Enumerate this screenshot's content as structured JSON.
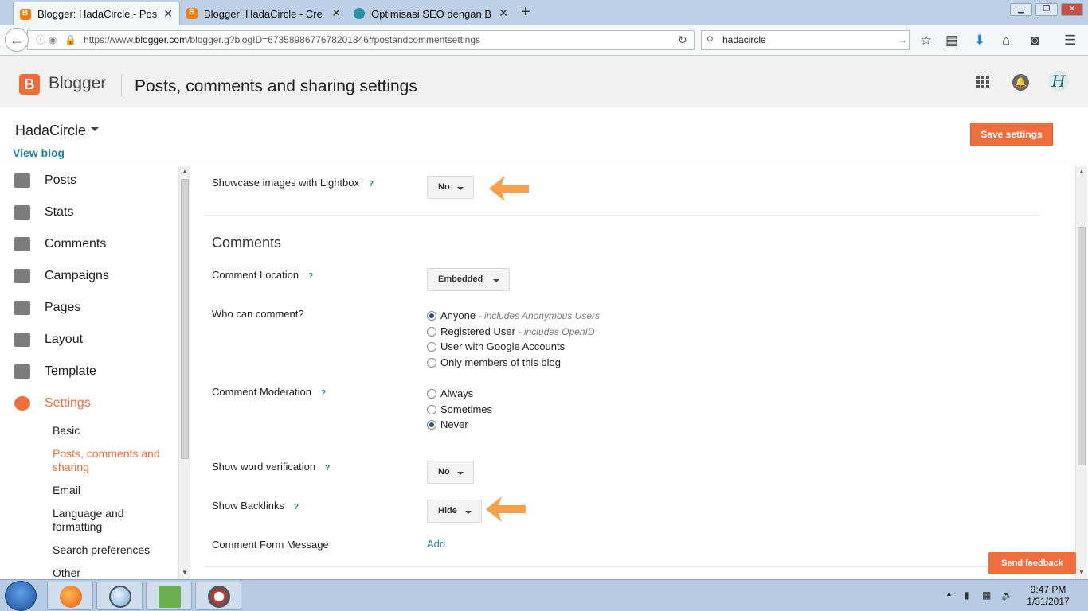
{
  "browser": {
    "tabs": [
      {
        "title": "Blogger: HadaCircle - Post...",
        "active": true
      },
      {
        "title": "Blogger: HadaCircle - Crea...",
        "active": false
      },
      {
        "title": "Optimisasi SEO dengan Blo...",
        "active": false
      }
    ],
    "url_prefix": "https://www.",
    "url_domain": "blogger.com",
    "url_rest": "/blogger.g?blogID=6735898677678201846#postandcommentsettings",
    "search_value": "hadacircle"
  },
  "header": {
    "brand": "Blogger",
    "page_title": "Posts, comments and sharing settings"
  },
  "blog": {
    "title": "HadaCircle",
    "view_blog": "View blog",
    "save_label": "Save settings"
  },
  "sidebar": {
    "items": [
      {
        "label": "Posts",
        "icon": "posts-icon"
      },
      {
        "label": "Stats",
        "icon": "stats-icon"
      },
      {
        "label": "Comments",
        "icon": "comments-icon"
      },
      {
        "label": "Campaigns",
        "icon": "campaigns-icon"
      },
      {
        "label": "Pages",
        "icon": "pages-icon"
      },
      {
        "label": "Layout",
        "icon": "layout-icon"
      },
      {
        "label": "Template",
        "icon": "template-icon"
      },
      {
        "label": "Settings",
        "icon": "gear-icon",
        "selected": true
      }
    ],
    "subitems": [
      {
        "label": "Basic"
      },
      {
        "label": "Posts, comments and sharing",
        "selected": true
      },
      {
        "label": "Email"
      },
      {
        "label": "Language and formatting"
      },
      {
        "label": "Search preferences"
      },
      {
        "label": "Other"
      }
    ]
  },
  "settings": {
    "lightbox_label": "Showcase images with Lightbox",
    "lightbox_value": "No",
    "comments_heading": "Comments",
    "location_label": "Comment Location",
    "location_value": "Embedded",
    "who_label": "Who can comment?",
    "who_options": [
      {
        "label": "Anyone",
        "sub": "- includes Anonymous Users",
        "checked": true
      },
      {
        "label": "Registered User",
        "sub": "- includes OpenID",
        "checked": false
      },
      {
        "label": "User with Google Accounts",
        "sub": "",
        "checked": false
      },
      {
        "label": "Only members of this blog",
        "sub": "",
        "checked": false
      }
    ],
    "moderation_label": "Comment Moderation",
    "moderation_options": [
      {
        "label": "Always",
        "checked": false
      },
      {
        "label": "Sometimes",
        "checked": false
      },
      {
        "label": "Never",
        "checked": true
      }
    ],
    "verification_label": "Show word verification",
    "verification_value": "No",
    "backlinks_label": "Show Backlinks",
    "backlinks_value": "Hide",
    "form_message_label": "Comment Form Message",
    "form_message_link": "Add",
    "help_mark": "?"
  },
  "feedback_label": "Send feedback",
  "taskbar": {
    "time": "9:47 PM",
    "date": "1/31/2017"
  },
  "colors": {
    "accent": "#f06d3e",
    "link": "#21819e",
    "annotation_arrow": "#f7a24a"
  }
}
